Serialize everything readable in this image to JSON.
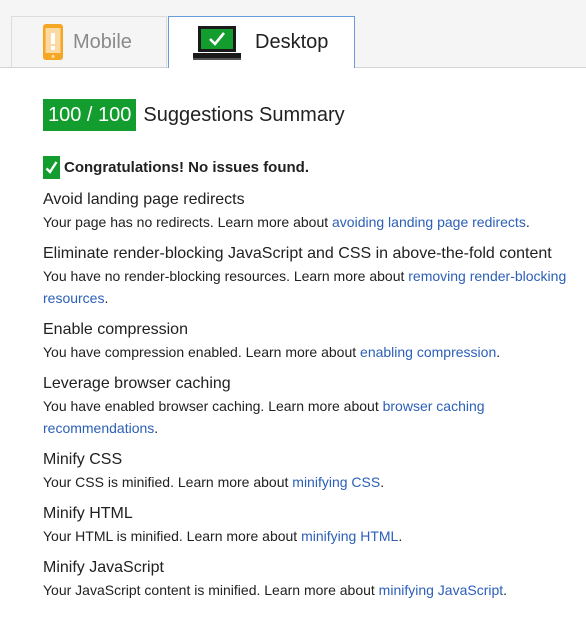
{
  "tabs": {
    "mobile_label": "Mobile",
    "desktop_label": "Desktop",
    "mobile_icon": "mobile-phone-icon",
    "desktop_icon": "laptop-check-icon"
  },
  "summary": {
    "score": "100 / 100",
    "title": "Suggestions Summary",
    "congrats": "Congratulations! No issues found."
  },
  "rules": [
    {
      "title": "Avoid landing page redirects",
      "desc": "Your page has no redirects. Learn more about ",
      "link": "avoiding landing page redirects",
      "end": "."
    },
    {
      "title": "Eliminate render-blocking JavaScript and CSS in above-the-fold content",
      "desc": "You have no render-blocking resources. Learn more about ",
      "link": "removing render-blocking resources",
      "end": "."
    },
    {
      "title": "Enable compression",
      "desc": "You have compression enabled. Learn more about ",
      "link": "enabling compression",
      "end": "."
    },
    {
      "title": "Leverage browser caching",
      "desc": "You have enabled browser caching. Learn more about ",
      "link": "browser caching recommendations",
      "end": "."
    },
    {
      "title": "Minify CSS",
      "desc": "Your CSS is minified. Learn more about ",
      "link": "minifying CSS",
      "end": "."
    },
    {
      "title": "Minify HTML",
      "desc": "Your HTML is minified. Learn more about ",
      "link": "minifying HTML",
      "end": "."
    },
    {
      "title": "Minify JavaScript",
      "desc": "Your JavaScript content is minified. Learn more about ",
      "link": "minifying JavaScript",
      "end": "."
    }
  ],
  "colors": {
    "score_green": "#139d2e",
    "link_blue": "#2b5fb8",
    "tab_active_border": "#6a9ae0",
    "phone_orange": "#f5a623"
  }
}
